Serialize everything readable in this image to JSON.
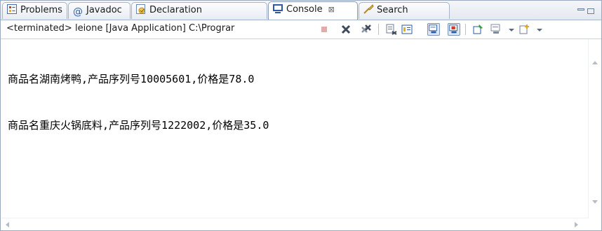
{
  "tabs": [
    {
      "label": "Problems",
      "icon": "problems-icon"
    },
    {
      "label": "Javadoc",
      "icon": "javadoc-icon"
    },
    {
      "label": "Declaration",
      "icon": "declaration-icon"
    },
    {
      "label": "Console",
      "icon": "console-icon",
      "active": true,
      "close": "⊠"
    },
    {
      "label": "Search",
      "icon": "search-icon"
    }
  ],
  "toolbar": {
    "status": "<terminated> leione [Java Application] C:\\Prograr"
  },
  "console": {
    "lines": [
      "商品名湖南烤鸭,产品序列号10005601,价格是78.0",
      "商品名重庆火锅底料,产品序列号1222002,价格是35.0"
    ]
  },
  "colors": {
    "border": "#9aa9bd",
    "tab_bg": "#e4e9f0",
    "accent": "#2a5aa8"
  }
}
